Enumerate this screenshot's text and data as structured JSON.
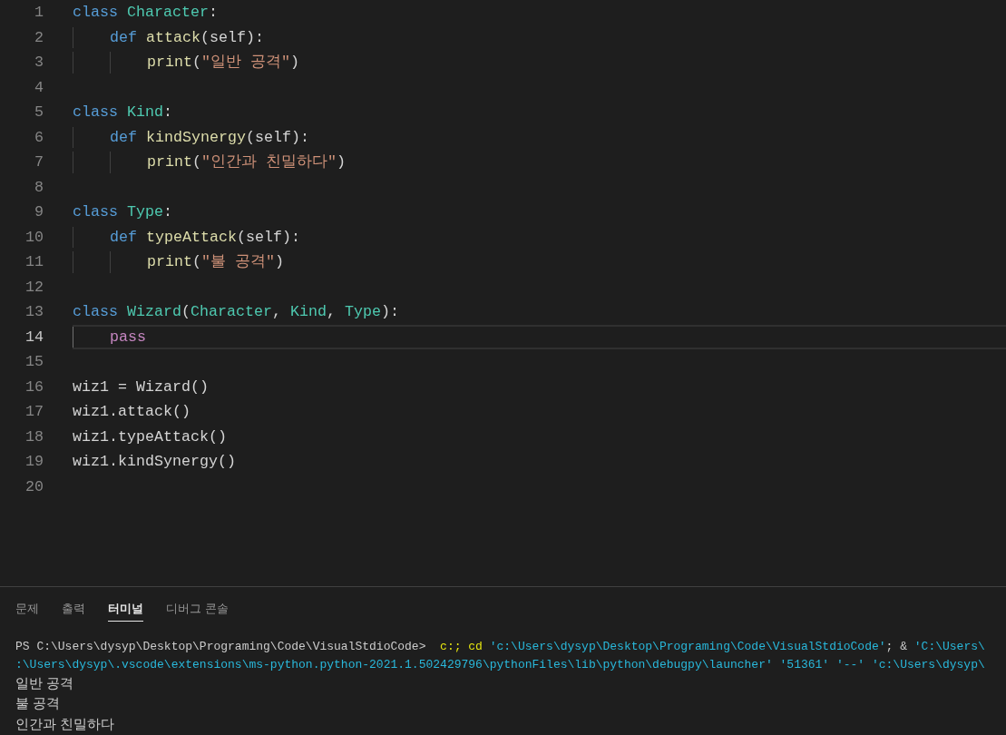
{
  "editor": {
    "lines": [
      {
        "number": "1",
        "current": false,
        "tokens": [
          {
            "kind": "keyword",
            "text": "class "
          },
          {
            "kind": "type",
            "text": "Character"
          },
          {
            "kind": "plain",
            "text": ":"
          }
        ]
      },
      {
        "number": "2",
        "current": false,
        "tokens": [
          {
            "kind": "keyword",
            "text": "    def "
          },
          {
            "kind": "function",
            "text": "attack"
          },
          {
            "kind": "plain",
            "text": "(self):"
          }
        ]
      },
      {
        "number": "3",
        "current": false,
        "tokens": [
          {
            "kind": "function",
            "text": "        print"
          },
          {
            "kind": "plain",
            "text": "("
          },
          {
            "kind": "string",
            "text": "\"일반 공격\""
          },
          {
            "kind": "plain",
            "text": ")"
          }
        ]
      },
      {
        "number": "4",
        "current": false
      },
      {
        "number": "5",
        "current": false,
        "tokens": [
          {
            "kind": "keyword",
            "text": "class "
          },
          {
            "kind": "type",
            "text": "Kind"
          },
          {
            "kind": "plain",
            "text": ":"
          }
        ]
      },
      {
        "number": "6",
        "current": false,
        "tokens": [
          {
            "kind": "keyword",
            "text": "    def "
          },
          {
            "kind": "function",
            "text": "kindSynergy"
          },
          {
            "kind": "plain",
            "text": "(self):"
          }
        ]
      },
      {
        "number": "7",
        "current": false,
        "tokens": [
          {
            "kind": "function",
            "text": "        print"
          },
          {
            "kind": "plain",
            "text": "("
          },
          {
            "kind": "string",
            "text": "\"인간과 친밀하다\""
          },
          {
            "kind": "plain",
            "text": ")"
          }
        ]
      },
      {
        "number": "8",
        "current": false
      },
      {
        "number": "9",
        "current": false,
        "tokens": [
          {
            "kind": "keyword",
            "text": "class "
          },
          {
            "kind": "type",
            "text": "Type"
          },
          {
            "kind": "plain",
            "text": ":"
          }
        ]
      },
      {
        "number": "10",
        "current": false,
        "tokens": [
          {
            "kind": "keyword",
            "text": "    def "
          },
          {
            "kind": "function",
            "text": "typeAttack"
          },
          {
            "kind": "plain",
            "text": "(self):"
          }
        ]
      },
      {
        "number": "11",
        "current": false,
        "tokens": [
          {
            "kind": "function",
            "text": "        print"
          },
          {
            "kind": "plain",
            "text": "("
          },
          {
            "kind": "string",
            "text": "\"불 공격\""
          },
          {
            "kind": "plain",
            "text": ")"
          }
        ]
      },
      {
        "number": "12",
        "current": false
      },
      {
        "number": "13",
        "current": false,
        "tokens": [
          {
            "kind": "keyword",
            "text": "class "
          },
          {
            "kind": "type",
            "text": "Wizard"
          },
          {
            "kind": "plain",
            "text": "("
          },
          {
            "kind": "type",
            "text": "Character"
          },
          {
            "kind": "plain",
            "text": ", "
          },
          {
            "kind": "type",
            "text": "Kind"
          },
          {
            "kind": "plain",
            "text": ", "
          },
          {
            "kind": "type",
            "text": "Type"
          },
          {
            "kind": "plain",
            "text": "):"
          }
        ]
      },
      {
        "number": "14",
        "current": true,
        "tokens": [
          {
            "kind": "control",
            "text": "    pass"
          }
        ]
      },
      {
        "number": "15",
        "current": false
      },
      {
        "number": "16",
        "current": false,
        "tokens": [
          {
            "kind": "plain",
            "text": "wiz1 = Wizard()"
          }
        ]
      },
      {
        "number": "17",
        "current": false,
        "tokens": [
          {
            "kind": "plain",
            "text": "wiz1.attack()"
          }
        ]
      },
      {
        "number": "18",
        "current": false,
        "tokens": [
          {
            "kind": "plain",
            "text": "wiz1.typeAttack()"
          }
        ]
      },
      {
        "number": "19",
        "current": false,
        "tokens": [
          {
            "kind": "plain",
            "text": "wiz1.kindSynergy()"
          }
        ]
      },
      {
        "number": "20",
        "current": false
      }
    ]
  },
  "panel": {
    "tabs": [
      {
        "label": "문제",
        "selected": false
      },
      {
        "label": "출력",
        "selected": false
      },
      {
        "label": "터미널",
        "selected": true
      },
      {
        "label": "디버그 콘솔",
        "selected": false
      }
    ],
    "terminal": [
      {
        "segments": [
          {
            "kind": "plain",
            "text": "PS C:\\Users\\dysyp\\Desktop\\Programing\\Code\\VisualStdioCode>  "
          },
          {
            "kind": "command",
            "text": "c:; cd "
          },
          {
            "kind": "string",
            "text": "'c:\\Users\\dysyp\\Desktop\\Programing\\Code\\VisualStdioCode'"
          },
          {
            "kind": "plain",
            "text": "; & "
          },
          {
            "kind": "string",
            "text": "'C:\\Users\\"
          }
        ]
      },
      {
        "segments": [
          {
            "kind": "string",
            "text": ":\\Users\\dysyp\\.vscode\\extensions\\ms-python.python-2021.1.502429796\\pythonFiles\\lib\\python\\debugpy\\launcher' '51361' '--' 'c:\\Users\\dysyp\\"
          }
        ]
      },
      {
        "segments": [
          {
            "kind": "output",
            "text": "일반 공격"
          }
        ]
      },
      {
        "segments": [
          {
            "kind": "output",
            "text": "불 공격"
          }
        ]
      },
      {
        "segments": [
          {
            "kind": "output",
            "text": "인간과 친밀하다"
          }
        ]
      }
    ]
  }
}
